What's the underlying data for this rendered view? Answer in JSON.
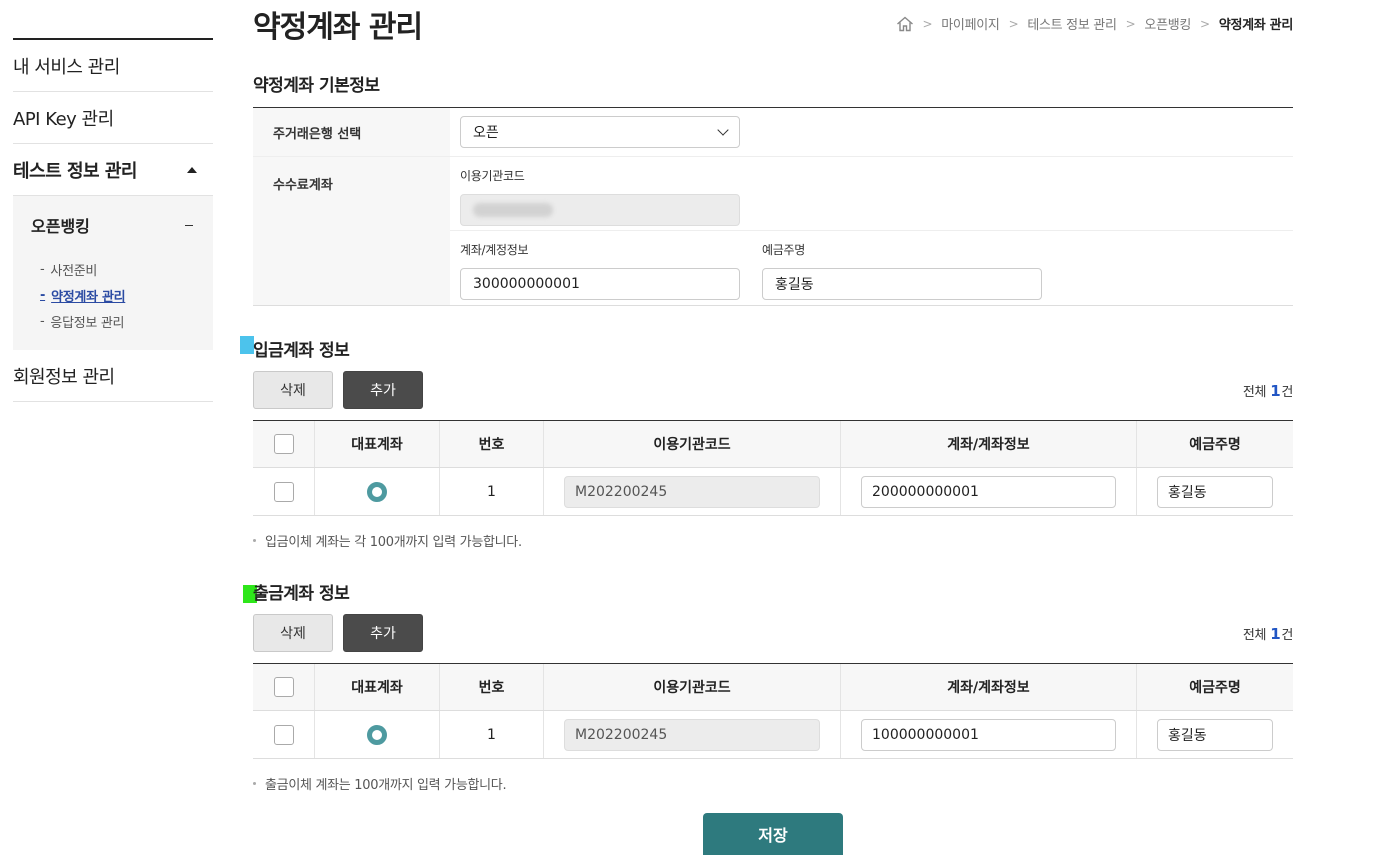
{
  "sidebar": {
    "items": [
      {
        "label": "내 서비스 관리"
      },
      {
        "label": "API Key 관리"
      },
      {
        "label": "테스트 정보 관리"
      },
      {
        "label": "회원정보 관리"
      }
    ],
    "sub_title": "오픈뱅킹",
    "sub_items": [
      {
        "label": "사전준비"
      },
      {
        "label": "약정계좌 관리"
      },
      {
        "label": "응답정보 관리"
      }
    ]
  },
  "header": {
    "title": "약정계좌 관리",
    "breadcrumb": [
      "마이페이지",
      "테스트 정보 관리",
      "오픈뱅킹",
      "약정계좌 관리"
    ]
  },
  "basic": {
    "section_title": "약정계좌 기본정보",
    "bank_label": "주거래은행 선택",
    "bank_value": "오픈",
    "fee_label": "수수료계좌",
    "org_code_label": "이용기관코드",
    "account_label": "계좌/계정정보",
    "account_value": "300000000001",
    "holder_label": "예금주명",
    "holder_value": "홍길동"
  },
  "deposit": {
    "section_title": "입금계좌 정보",
    "delete_label": "삭제",
    "add_label": "추가",
    "count_prefix": "전체",
    "count": "1",
    "count_suffix": "건",
    "headers": [
      "대표계좌",
      "번호",
      "이용기관코드",
      "계좌/계좌정보",
      "예금주명"
    ],
    "rows": [
      {
        "no": "1",
        "org_code": "M202200245",
        "account": "200000000001",
        "holder": "홍길동"
      }
    ],
    "note": "입금이체 계좌는 각 100개까지 입력 가능합니다."
  },
  "withdraw": {
    "section_title": "출금계좌 정보",
    "delete_label": "삭제",
    "add_label": "추가",
    "count_prefix": "전체",
    "count": "1",
    "count_suffix": "건",
    "headers": [
      "대표계좌",
      "번호",
      "이용기관코드",
      "계좌/계좌정보",
      "예금주명"
    ],
    "rows": [
      {
        "no": "1",
        "org_code": "M202200245",
        "account": "100000000001",
        "holder": "홍길동"
      }
    ],
    "note": "출금이체 계좌는 100개까지 입력 가능합니다."
  },
  "save_label": "저장",
  "colors": {
    "accent": "#2e7a7e",
    "radio": "#4e9aa0",
    "count_number": "#2256c4",
    "sidebar_current": "#2b4ba3",
    "marker_deposit": "#4cc3ec",
    "marker_withdraw": "#2ee61a"
  },
  "icons": {
    "home": "home-icon",
    "breadcrumb_separator": "chevron-right-icon",
    "select": "chevron-down-icon",
    "expanded": "triangle-up-icon",
    "collapse": "minus-icon"
  }
}
